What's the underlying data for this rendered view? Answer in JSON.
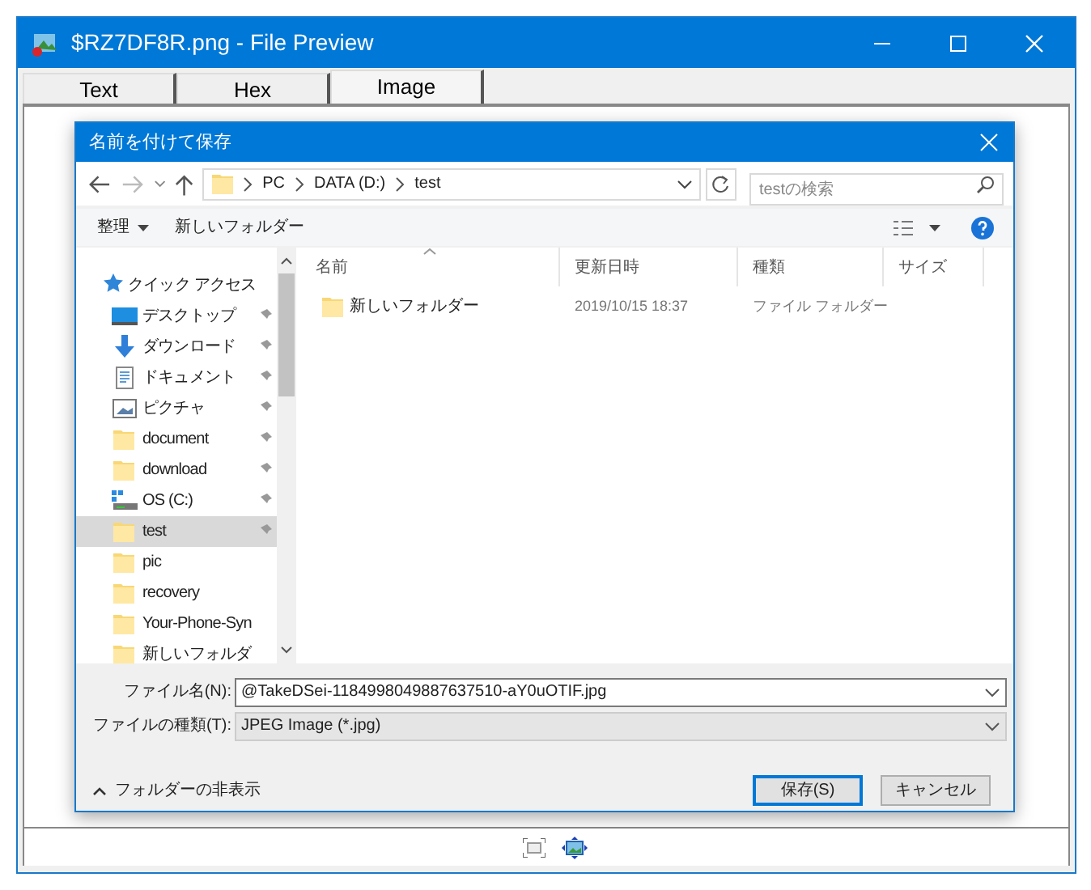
{
  "window": {
    "title": "$RZ7DF8R.png - File Preview"
  },
  "tabs": [
    {
      "label": "Text",
      "selected": false
    },
    {
      "label": "Hex",
      "selected": false
    },
    {
      "label": "Image",
      "selected": true
    }
  ],
  "dialog": {
    "title": "名前を付けて保存",
    "breadcrumb": [
      "PC",
      "DATA (D:)",
      "test"
    ],
    "search": {
      "placeholder": "testの検索"
    },
    "toolbar": {
      "organize": "整理",
      "new_folder": "新しいフォルダー"
    },
    "sidebar": {
      "items": [
        {
          "label": "クイック アクセス",
          "kind": "star",
          "selected": false,
          "children": [
            {
              "label": "デスクトップ",
              "kind": "desktop",
              "pinned": true,
              "selected": false
            },
            {
              "label": "ダウンロード",
              "kind": "download",
              "pinned": true,
              "selected": false
            },
            {
              "label": "ドキュメント",
              "kind": "document",
              "pinned": true,
              "selected": false
            },
            {
              "label": "ピクチャ",
              "kind": "pictures",
              "pinned": true,
              "selected": false
            },
            {
              "label": "document",
              "kind": "folder",
              "pinned": true,
              "selected": false
            },
            {
              "label": "download",
              "kind": "folder",
              "pinned": true,
              "selected": false
            },
            {
              "label": "OS (C:)",
              "kind": "drive",
              "pinned": true,
              "selected": false
            },
            {
              "label": "test",
              "kind": "folder",
              "pinned": true,
              "selected": true
            },
            {
              "label": "pic",
              "kind": "folder",
              "pinned": false,
              "selected": false
            },
            {
              "label": "recovery",
              "kind": "folder",
              "pinned": false,
              "selected": false
            },
            {
              "label": "Your-Phone-Syn",
              "kind": "folder",
              "pinned": false,
              "selected": false
            },
            {
              "label": "新しいフォルダ",
              "kind": "folder",
              "pinned": false,
              "selected": false
            }
          ]
        }
      ]
    },
    "columns": [
      "名前",
      "更新日時",
      "種類",
      "サイズ"
    ],
    "rows": [
      {
        "name": "新しいフォルダー",
        "modified": "2019/10/15 18:37",
        "type": "ファイル フォルダー"
      }
    ],
    "file_name": {
      "label": "ファイル名(N):",
      "value": "@TakeDSei-1184998049887637510-aY0uOTIF.jpg"
    },
    "file_type": {
      "label": "ファイルの種類(T):",
      "value": "JPEG Image (*.jpg)"
    },
    "hide_folders": "フォルダーの非表示",
    "buttons": [
      "保存(S)",
      "キャンセル"
    ]
  }
}
